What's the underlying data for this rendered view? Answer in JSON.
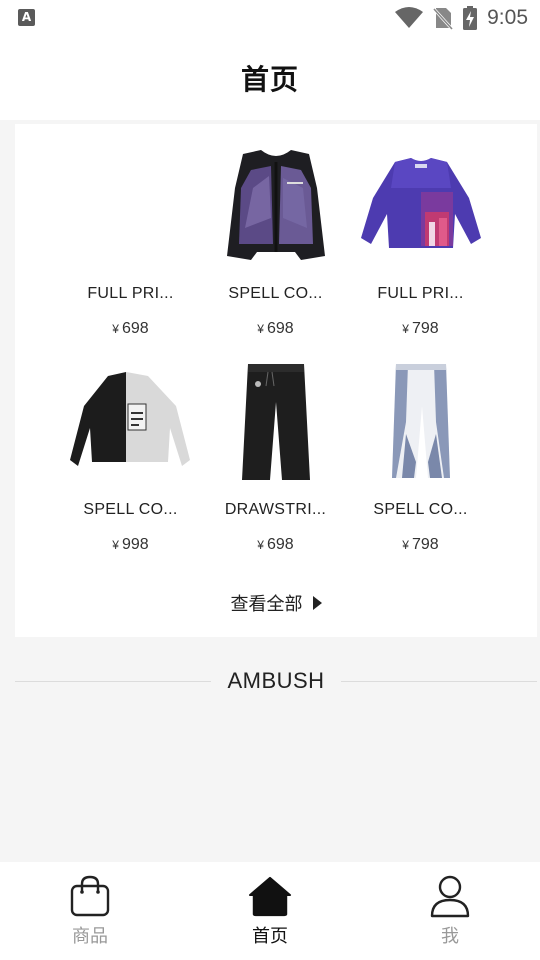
{
  "status_bar": {
    "time": "9:05",
    "app_icon_letter": "A"
  },
  "header": {
    "title": "首页"
  },
  "products": [
    {
      "name": "FULL PRI...",
      "currency": "¥",
      "price": "698",
      "image": "blank"
    },
    {
      "name": "SPELL CO...",
      "currency": "¥",
      "price": "698",
      "image": "vest"
    },
    {
      "name": "FULL PRI...",
      "currency": "¥",
      "price": "798",
      "image": "purple-shirt"
    },
    {
      "name": "SPELL CO...",
      "currency": "¥",
      "price": "998",
      "image": "sweater"
    },
    {
      "name": "DRAWSTRI...",
      "currency": "¥",
      "price": "698",
      "image": "black-pants"
    },
    {
      "name": "SPELL CO...",
      "currency": "¥",
      "price": "798",
      "image": "white-pants"
    }
  ],
  "view_all": {
    "label": "查看全部"
  },
  "brand": {
    "name": "AMBUSH"
  },
  "tabbar": {
    "items": [
      {
        "label": "商品",
        "icon": "shopping-bag-icon",
        "active": false
      },
      {
        "label": "首页",
        "icon": "home-icon",
        "active": true
      },
      {
        "label": "我",
        "icon": "user-icon",
        "active": false
      }
    ]
  },
  "colors": {
    "accent": "#111111",
    "inactive": "#999999",
    "background": "#f5f5f5"
  }
}
